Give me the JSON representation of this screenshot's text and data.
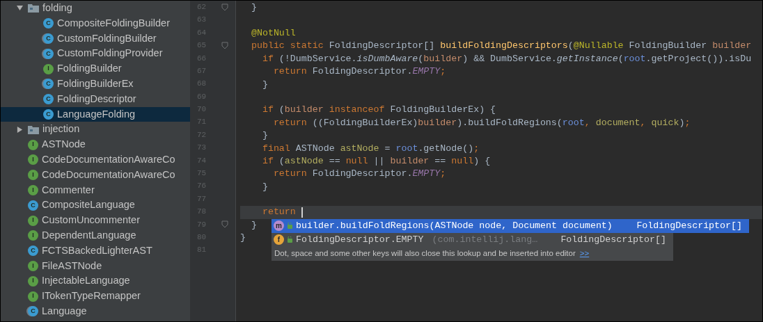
{
  "project_tree": [
    {
      "kind": "folder",
      "label": "folding",
      "expanded": true,
      "selected": false,
      "children": [
        {
          "kind": "class",
          "badge": "C",
          "label": "CompositeFoldingBuilder",
          "selected": false
        },
        {
          "kind": "abstract",
          "badge": "C",
          "label": "CustomFoldingBuilder",
          "selected": false
        },
        {
          "kind": "abstract",
          "badge": "C",
          "label": "CustomFoldingProvider",
          "selected": false
        },
        {
          "kind": "interface",
          "badge": "I",
          "label": "FoldingBuilder",
          "selected": false
        },
        {
          "kind": "abstract",
          "badge": "C",
          "label": "FoldingBuilderEx",
          "selected": false
        },
        {
          "kind": "class",
          "badge": "C",
          "label": "FoldingDescriptor",
          "selected": false
        },
        {
          "kind": "class",
          "badge": "C",
          "label": "LanguageFolding",
          "selected": true
        }
      ]
    },
    {
      "kind": "folder",
      "label": "injection",
      "expanded": false,
      "selected": false
    },
    {
      "kind": "interface",
      "badge": "I",
      "label": "ASTNode",
      "selected": false
    },
    {
      "kind": "interface",
      "badge": "I",
      "label": "CodeDocumentationAwareCo",
      "selected": false
    },
    {
      "kind": "interface",
      "badge": "I",
      "label": "CodeDocumentationAwareCo",
      "selected": false
    },
    {
      "kind": "interface",
      "badge": "I",
      "label": "Commenter",
      "selected": false
    },
    {
      "kind": "class",
      "badge": "C",
      "label": "CompositeLanguage",
      "selected": false
    },
    {
      "kind": "interface",
      "badge": "I",
      "label": "CustomUncommenter",
      "selected": false
    },
    {
      "kind": "interface",
      "badge": "I",
      "label": "DependentLanguage",
      "selected": false
    },
    {
      "kind": "class",
      "badge": "C",
      "label": "FCTSBackedLighterAST",
      "selected": false
    },
    {
      "kind": "interface",
      "badge": "I",
      "label": "FileASTNode",
      "selected": false
    },
    {
      "kind": "interface",
      "badge": "I",
      "label": "InjectableLanguage",
      "selected": false
    },
    {
      "kind": "interface",
      "badge": "I",
      "label": "ITokenTypeRemapper",
      "selected": false
    },
    {
      "kind": "abstract",
      "badge": "C",
      "label": "Language",
      "selected": false
    }
  ],
  "editor": {
    "lines": [
      {
        "number": "62",
        "fold_marker": true,
        "current": false,
        "caret": false,
        "tokens": [
          {
            "text": "  }",
            "kind": "plain"
          }
        ]
      },
      {
        "number": "63",
        "fold_marker": false,
        "current": false,
        "caret": false
      },
      {
        "number": "64",
        "fold_marker": false,
        "current": false,
        "caret": false,
        "tokens": [
          {
            "text": "  @NotNull",
            "kind": "annotation"
          }
        ]
      },
      {
        "number": "65",
        "fold_marker": true,
        "current": false,
        "caret": false,
        "tokens": [
          {
            "text": "  public static ",
            "kind": "keyword"
          },
          {
            "text": "FoldingDescriptor[] ",
            "kind": "plain"
          },
          {
            "text": "buildFoldingDescriptors",
            "kind": "declaration"
          },
          {
            "text": "(",
            "kind": "plain"
          },
          {
            "text": "@Nullable",
            "kind": "annotation"
          },
          {
            "text": " FoldingBuilder ",
            "kind": "plain"
          },
          {
            "text": "builder",
            "kind": "parameter"
          }
        ]
      },
      {
        "number": "66",
        "fold_marker": false,
        "current": false,
        "caret": false,
        "tokens": [
          {
            "text": "    if ",
            "kind": "keyword"
          },
          {
            "text": "(!DumbService.",
            "kind": "plain"
          },
          {
            "text": "isDumbAware",
            "kind": "static_method"
          },
          {
            "text": "(",
            "kind": "plain"
          },
          {
            "text": "builder",
            "kind": "parameter"
          },
          {
            "text": ") && DumbService.",
            "kind": "plain"
          },
          {
            "text": "getInstance",
            "kind": "static_method"
          },
          {
            "text": "(",
            "kind": "plain"
          },
          {
            "text": "root",
            "kind": "field"
          },
          {
            "text": ".getProject()).isDu",
            "kind": "plain"
          }
        ]
      },
      {
        "number": "67",
        "fold_marker": false,
        "current": false,
        "caret": false,
        "tokens": [
          {
            "text": "      return ",
            "kind": "keyword"
          },
          {
            "text": "FoldingDescriptor.",
            "kind": "plain"
          },
          {
            "text": "EMPTY",
            "kind": "static_field"
          },
          {
            "text": ";",
            "kind": "keyword"
          }
        ]
      },
      {
        "number": "68",
        "fold_marker": false,
        "current": false,
        "caret": false,
        "tokens": [
          {
            "text": "    }",
            "kind": "plain"
          }
        ]
      },
      {
        "number": "69",
        "fold_marker": false,
        "current": false,
        "caret": false
      },
      {
        "number": "70",
        "fold_marker": false,
        "current": false,
        "caret": false,
        "tokens": [
          {
            "text": "    if ",
            "kind": "keyword"
          },
          {
            "text": "(",
            "kind": "plain"
          },
          {
            "text": "builder",
            "kind": "parameter"
          },
          {
            "text": " instanceof ",
            "kind": "keyword"
          },
          {
            "text": "FoldingBuilderEx) {",
            "kind": "plain"
          }
        ]
      },
      {
        "number": "71",
        "fold_marker": false,
        "current": false,
        "caret": false,
        "tokens": [
          {
            "text": "      return ",
            "kind": "keyword"
          },
          {
            "text": "((FoldingBuilderEx)",
            "kind": "plain"
          },
          {
            "text": "builder",
            "kind": "parameter"
          },
          {
            "text": ").buildFoldRegions(",
            "kind": "plain"
          },
          {
            "text": "root",
            "kind": "field"
          },
          {
            "text": ",",
            "kind": "keyword"
          },
          {
            "text": " document",
            "kind": "local"
          },
          {
            "text": ",",
            "kind": "keyword"
          },
          {
            "text": " quick",
            "kind": "local"
          },
          {
            "text": ")",
            "kind": "plain"
          },
          {
            "text": ";",
            "kind": "keyword"
          }
        ]
      },
      {
        "number": "72",
        "fold_marker": false,
        "current": false,
        "caret": false,
        "tokens": [
          {
            "text": "    }",
            "kind": "plain"
          }
        ]
      },
      {
        "number": "73",
        "fold_marker": false,
        "current": false,
        "caret": false,
        "tokens": [
          {
            "text": "    final ",
            "kind": "keyword"
          },
          {
            "text": "ASTNode ",
            "kind": "plain"
          },
          {
            "text": "astNode",
            "kind": "local"
          },
          {
            "text": " = ",
            "kind": "plain"
          },
          {
            "text": "root",
            "kind": "field"
          },
          {
            "text": ".getNode()",
            "kind": "plain"
          },
          {
            "text": ";",
            "kind": "keyword"
          }
        ]
      },
      {
        "number": "74",
        "fold_marker": false,
        "current": false,
        "caret": false,
        "tokens": [
          {
            "text": "    if ",
            "kind": "keyword"
          },
          {
            "text": "(",
            "kind": "plain"
          },
          {
            "text": "astNode",
            "kind": "local"
          },
          {
            "text": " == ",
            "kind": "plain"
          },
          {
            "text": "null ",
            "kind": "keyword"
          },
          {
            "text": "|| ",
            "kind": "plain"
          },
          {
            "text": "builder",
            "kind": "parameter"
          },
          {
            "text": " == ",
            "kind": "plain"
          },
          {
            "text": "null",
            "kind": "keyword"
          },
          {
            "text": ") {",
            "kind": "plain"
          }
        ]
      },
      {
        "number": "75",
        "fold_marker": false,
        "current": false,
        "caret": false,
        "tokens": [
          {
            "text": "      return ",
            "kind": "keyword"
          },
          {
            "text": "FoldingDescriptor.",
            "kind": "plain"
          },
          {
            "text": "EMPTY",
            "kind": "static_field"
          },
          {
            "text": ";",
            "kind": "keyword"
          }
        ]
      },
      {
        "number": "76",
        "fold_marker": false,
        "current": false,
        "caret": false,
        "tokens": [
          {
            "text": "    }",
            "kind": "plain"
          }
        ]
      },
      {
        "number": "77",
        "fold_marker": false,
        "current": false,
        "caret": false
      },
      {
        "number": "78",
        "fold_marker": false,
        "current": true,
        "caret": true,
        "tokens": [
          {
            "text": "    return ",
            "kind": "keyword"
          }
        ]
      },
      {
        "number": "79",
        "fold_marker": true,
        "current": false,
        "caret": false,
        "tokens": [
          {
            "text": "  }",
            "kind": "plain"
          }
        ]
      },
      {
        "number": "80",
        "fold_marker": false,
        "current": false,
        "caret": false,
        "tokens": [
          {
            "text": "}",
            "kind": "plain"
          }
        ]
      },
      {
        "number": "81",
        "fold_marker": false,
        "current": false,
        "caret": false
      }
    ]
  },
  "completion_popup": {
    "items": [
      {
        "kind": "method",
        "badge": "m",
        "text": "builder.buildFoldRegions(ASTNode node, Document document)",
        "type": "FoldingDescriptor[]",
        "selected": true
      },
      {
        "kind": "field",
        "badge": "f",
        "text": "FoldingDescriptor.EMPTY",
        "location": "(com.intellij.lang…",
        "type": "FoldingDescriptor[]",
        "selected": false
      }
    ],
    "hint": "Dot, space and some other keys will also close this lookup and be inserted into editor",
    "hint_link": ">>"
  }
}
